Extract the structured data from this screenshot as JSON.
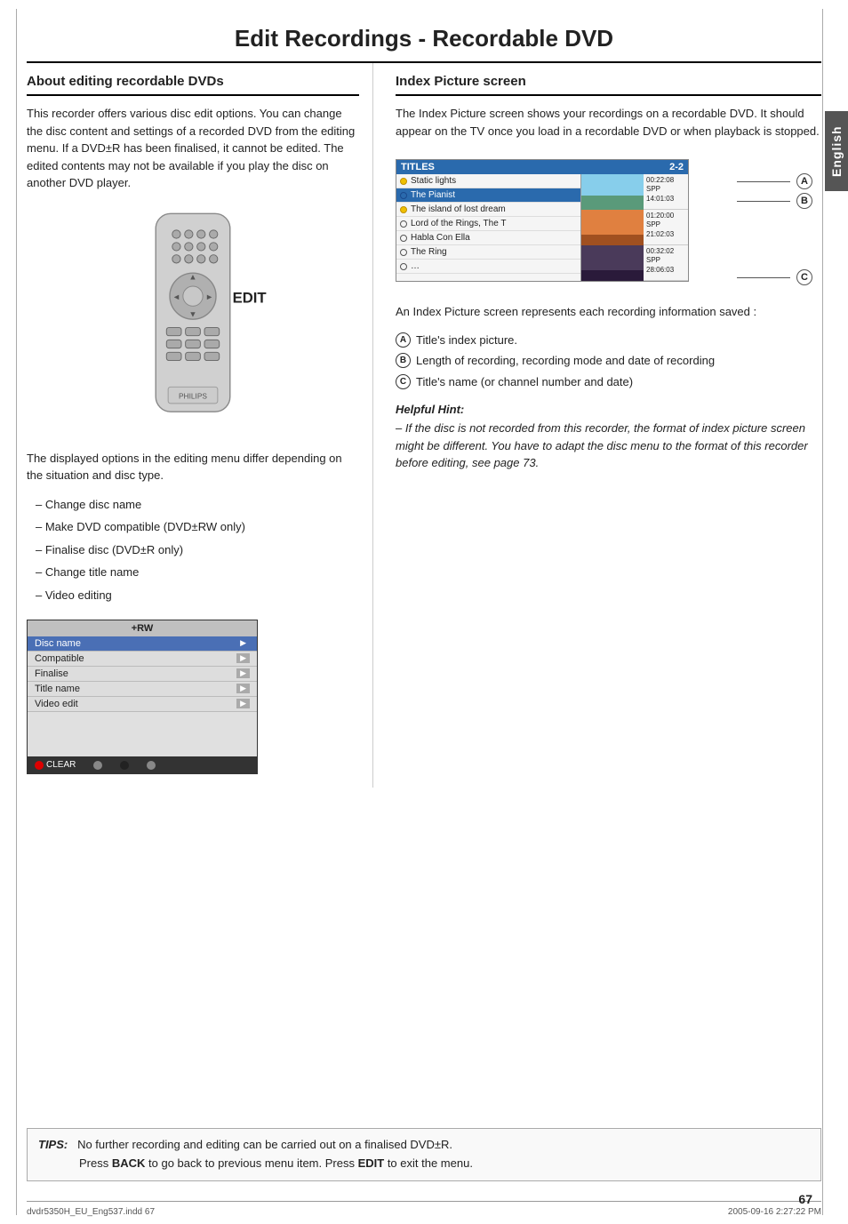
{
  "page": {
    "main_title": "Edit Recordings - Recordable DVD",
    "side_tab_label": "English",
    "left_section": {
      "heading": "About editing recordable DVDs",
      "body1": "This recorder offers various disc edit options. You can change the disc content and settings of a recorded DVD from the editing menu. If a DVD±R has been finalised, it cannot be edited. The edited contents may not be available if you play the disc on another DVD player.",
      "remote_edit_label": "EDIT",
      "body2": "The displayed options in the editing menu differ depending on the situation and disc type.",
      "dash_items": [
        "Change disc name",
        "Make DVD compatible (DVD±RW only)",
        "Finalise disc (DVD±R only)",
        "Change title name",
        "Video editing"
      ],
      "edit_menu": {
        "header": "+RW",
        "items": [
          {
            "label": "Disc name",
            "highlight": true
          },
          {
            "label": "Compatible",
            "highlight": false
          },
          {
            "label": "Finalise",
            "highlight": false
          },
          {
            "label": "Title name",
            "highlight": false
          },
          {
            "label": "Video edit",
            "highlight": false
          }
        ],
        "footer_clear": "CLEAR"
      }
    },
    "right_section": {
      "heading": "Index Picture screen",
      "body1": "The Index Picture screen shows your recordings on a recordable DVD.  It should appear on the TV once you load in a recordable DVD or when playback is stopped.",
      "index_box": {
        "titles_label": "TITLES",
        "titles_count": "2-2",
        "items": [
          {
            "icon": "yellow",
            "label": "Static lights",
            "selected": false
          },
          {
            "icon": "blue",
            "label": "The Pianist",
            "selected": true
          },
          {
            "icon": "yellow",
            "label": "The island of lost dream",
            "selected": false
          },
          {
            "icon": "empty",
            "label": "Lord of the Rings, The T",
            "selected": false
          },
          {
            "icon": "empty",
            "label": "Habla Con Ella",
            "selected": false
          },
          {
            "icon": "empty",
            "label": "The Ring",
            "selected": false
          },
          {
            "icon": "empty",
            "label": "…",
            "selected": false
          }
        ],
        "thumbnails": [
          {
            "time": "00:22:08",
            "mode": "SPP",
            "date": "14:01:03",
            "class": "blue-sky"
          },
          {
            "time": "01:20:00",
            "mode": "SPP",
            "date": "21:02:03",
            "class": "orange"
          },
          {
            "time": "00:32:02",
            "mode": "SPP",
            "date": "28:06:03",
            "class": "dark"
          }
        ]
      },
      "body2": "An Index Picture screen represents each recording information saved :",
      "info_items": [
        {
          "label": "A",
          "text": "Title's index picture."
        },
        {
          "label": "B",
          "text": "Length of recording, recording mode and date of recording"
        },
        {
          "label": "C",
          "text": "Title's name (or channel number and date)"
        }
      ],
      "hint_title": "Helpful Hint:",
      "hint_text": "– If the disc is not recorded from this recorder, the format of index picture screen might be different. You have to adapt the disc menu to the format of this recorder before editing, see page 73."
    },
    "tips_text": "No further recording and editing can be carried out on a finalised DVD±R.",
    "tips_label": "TIPS:",
    "tips_back": "Press BACK to go back to previous menu item. Press EDIT to exit the menu.",
    "page_number": "67",
    "footer_file": "dvdr5350H_EU_Eng537.indd   67",
    "footer_date": "2005-09-16   2:27:22 PM"
  }
}
